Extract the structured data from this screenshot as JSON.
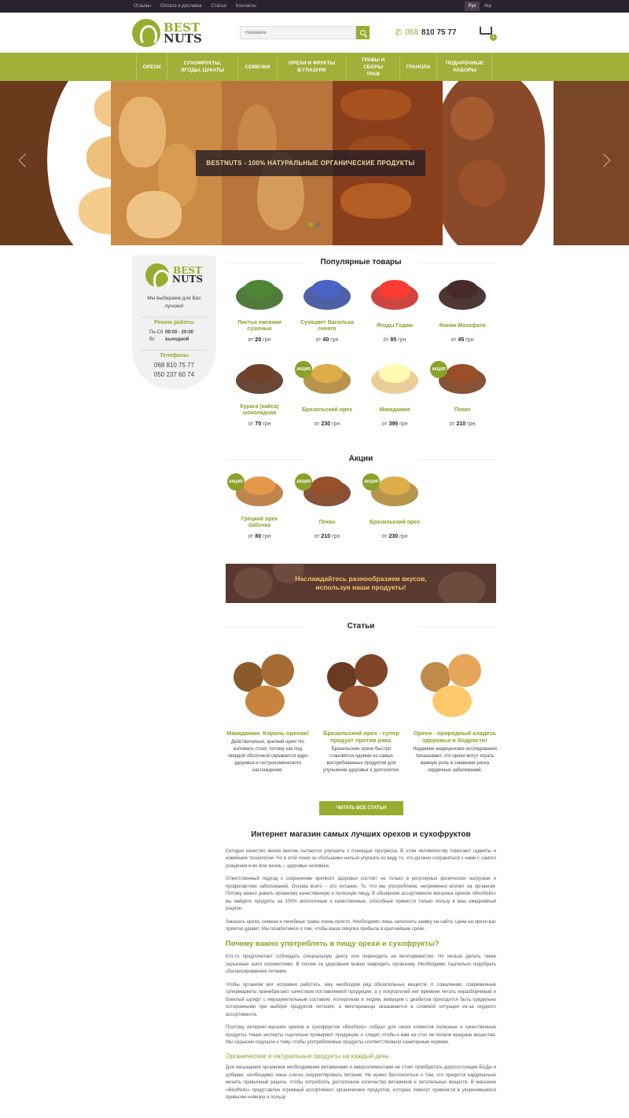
{
  "topbar": {
    "links": [
      "Отзывы",
      "Оплата и доставка",
      "Статьи",
      "Контакты"
    ],
    "languages": [
      {
        "label": "Рус",
        "active": true
      },
      {
        "label": "Укр",
        "active": false
      }
    ]
  },
  "header": {
    "logo": {
      "line1": "BEST",
      "line2": "NUTS"
    },
    "search_placeholder": "Название",
    "phone_code": "068",
    "phone_number": "810 75 77",
    "cart_count": "1"
  },
  "nav": [
    "Орехи",
    "Сухофрукты, ягоды, цукаты",
    "Семечки",
    "Орехи и фрукты в глазури",
    "Травы и сборы трав",
    "Гранола",
    "Подарочные наборы"
  ],
  "hero": {
    "caption": "BESTNUTS - 100% НАТУРАЛЬНЫЕ ОРГАНИЧЕСКИЕ ПРОДУКТЫ",
    "active_dot": 0,
    "dots": 2
  },
  "sidebar": {
    "logo": {
      "line1": "BEST",
      "line2": "NUTS"
    },
    "motto": "Мы выбираем для Вас лучшее!",
    "hours_title": "Режим работы",
    "hours": [
      {
        "days": "Пн-Сб",
        "time": "09:00 - 20:00"
      },
      {
        "days": "Вс",
        "time": "выходной"
      }
    ],
    "phones_title": "Телефоны",
    "phones": [
      "068 810 75 77",
      "050 237 60 74"
    ]
  },
  "popular": {
    "title": "Популярные товары",
    "items": [
      {
        "name": "Листья ежевики сушеные",
        "price_prefix": "от",
        "price": "20",
        "currency": "грн",
        "sale": false,
        "color": "#3f6b2a"
      },
      {
        "name": "Сухоцвет Василька синего",
        "price_prefix": "от",
        "price": "40",
        "currency": "грн",
        "sale": false,
        "color": "#3b4f9c"
      },
      {
        "name": "Ягоды Годжи",
        "price_prefix": "от",
        "price": "85",
        "currency": "грн",
        "sale": false,
        "color": "#c9302a"
      },
      {
        "name": "Финик Мазофати",
        "price_prefix": "от",
        "price": "45",
        "currency": "грн",
        "sale": false,
        "color": "#3a2220"
      },
      {
        "name": "Курага (кайса) шоколадная",
        "price_prefix": "от",
        "price": "70",
        "currency": "грн",
        "sale": false,
        "color": "#5a3320"
      },
      {
        "name": "Бразильский орех",
        "price_prefix": "от",
        "price": "230",
        "currency": "грн",
        "sale": true,
        "color": "#b08a3a"
      },
      {
        "name": "Макадамия",
        "price_prefix": "от",
        "price": "395",
        "currency": "грн",
        "sale": false,
        "color": "#e8c98e"
      },
      {
        "name": "Пекан",
        "price_prefix": "от",
        "price": "210",
        "currency": "грн",
        "sale": true,
        "color": "#7a3f1f"
      }
    ]
  },
  "sales": {
    "title": "Акции",
    "badge": "АКЦИЯ",
    "items": [
      {
        "name": "Грецкий орех бабочка",
        "price_prefix": "от",
        "price": "80",
        "currency": "грн",
        "color": "#b7793b"
      },
      {
        "name": "Пекан",
        "price_prefix": "от",
        "price": "210",
        "currency": "грн",
        "color": "#7a3f1f"
      },
      {
        "name": "Бразильский орех",
        "price_prefix": "от",
        "price": "230",
        "currency": "грн",
        "color": "#b08a3a"
      }
    ]
  },
  "banner": {
    "text": "Наслаждайтесь разнообразием вкусов, используя наши продукты!"
  },
  "articles": {
    "title": "Статьи",
    "items": [
      {
        "title": "Макадамия. Король орехов!",
        "text": "Действительно, крепкий орех! Но взломать стоит, потому как под твердой оболочкой скрывается ядро здоровья и гастрономического наслаждения.",
        "color": "#8a5a2b"
      },
      {
        "title": "Бразильский орех - супер продукт против рака.",
        "text": "Бразильские орехи быстро становятся одними из самых востребованных продуктов для улучшения здоровья и долголетия.",
        "color": "#6b3a22"
      },
      {
        "title": "Орехи - природный кладезь здоровья и бодрости!",
        "text": "Недавние медицинские исследования показывают, что орехи могут играть важную роль в снижении риска сердечных заболеваний.",
        "color": "#c08a4a"
      }
    ],
    "read_all": "ЧИТАТЬ ВСЕ СТАТЬИ"
  },
  "seo": {
    "title": "Интернет магазин самых лучших орехов и сухофруктов",
    "p1": "Сегодня качество жизни многие пытаются улучшить с помощью прогресса. В этом человечеству помогают гаджеты и новейшие технологии. Но в этой гонке за «большим» нельзя упускать из виду то, что должно сохраняться с нами с самого рождения и во всю жизнь – здоровье человека.",
    "p2": "Ответственный подход к сохранению крепкого здоровья состоит не только в регулярных физических нагрузках и профилактике заболеваний. Основа всего – это питание. То, что мы употребляем, непременно влияет на организм. Потому важно давать организму качественную и полезную пищу. В обширном ассортименте магазина орехов «BestNuts» вы найдете продукты на 100% экологичные и качественные, способные принести только пользу в ваш ежедневный рацион.",
    "p3": "Заказать орехи, семена и лечебные травы очень просто. Необходимо лишь заполнить заявку на сайте. Цена на орехи вас приятно удивит. Мы позаботимся о том, чтобы ваша покупка прибыла в кратчайшие сроки.",
    "h2": "Почему важно употреблять в пищу орехи и сухофрукты?",
    "p4": "Кто-то предпочитает соблюдать специальную диету или переходить на вегетарианство. Но нельзя делать такие серьезные шаги опрометчиво. В погоне за здоровьем можно навредить организму. Необходимо тщательно подобрать сбалансированное питание.",
    "p5": "Чтобы организм мог исправно работать, ему необходим ряд обязательных веществ. К сожалению, современные супермаркеты пренебрегают качеством поставляемой продукции, а у покупателей нет времени читать неразборчивый и блеклый шрифт с неразумительным составом. Аллергикам и людям, живущим с диабетом приходится быть предельно осторожными при выборе продуктов питания, а вегетарианцы оказываются в сложной ситуации из-за скудного ассортимента.",
    "p6": "Поэтому интернет-магазин орехов и сухофруктов «BestNuts» собрал для своих клиентов полезные и качественные продукты. Наши эксперты тщательно проверяют продукцию и следят, чтобы к вам на стол не попали вредные вещества. Мы серьезно подошли к тому, чтобы употребляемые продукты соответствовали санитарным нормам.",
    "h3": "Органические и натуральные продукты на каждый день",
    "p7": "Для насыщения организма необходимыми витаминами и микроэлементами не стоит приобретать дорогостоящие БАДы и добавки, необходимо лишь слегка скорректировать питание. Не нужно беспокоиться о том, что придется кардинально менять привычный рацион, чтобы потреблять достаточное количество витаминов и питательных веществ. В магазине «BestNuts» представлен огромный ассортимент органических продуктов, которые помогут привнести в укоренившиеся привычки новизну и пользу."
  }
}
